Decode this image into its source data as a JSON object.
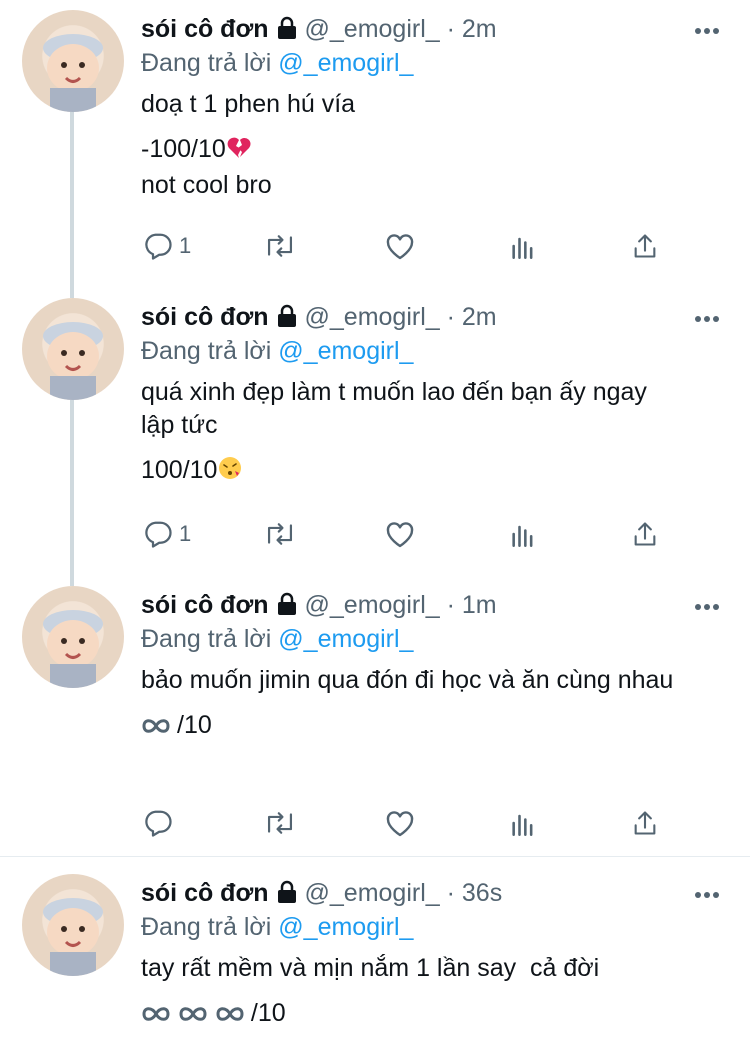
{
  "tweets": [
    {
      "name": "sói cô đơn",
      "handle": "@_emogirl_",
      "time": "· 2m",
      "reply_label": "Đang trả lời",
      "reply_mention": "@_emogirl_",
      "lines": [
        "doạ t 1 phen hú vía",
        "-100/10",
        "not cool bro"
      ],
      "line_emoji": [
        "",
        "broken-heart-emoji",
        ""
      ],
      "reply_count": "1"
    },
    {
      "name": "sói cô đơn",
      "handle": "@_emogirl_",
      "time": "· 2m",
      "reply_label": "Đang trả lời",
      "reply_mention": "@_emogirl_",
      "lines": [
        "quá xinh đẹp làm t muốn lao đến bạn ấy ngay lập tức",
        "100/10"
      ],
      "line_emoji": [
        "",
        "kissing-face-emoji"
      ],
      "reply_count": "1"
    },
    {
      "name": "sói cô đơn",
      "handle": "@_emogirl_",
      "time": "· 1m",
      "reply_label": "Đang trả lời",
      "reply_mention": "@_emogirl_",
      "lines": [
        "bảo muốn jimin qua đón đi học và ăn cùng nhau",
        "/10"
      ],
      "line_emoji": [
        "",
        "infinity-emoji"
      ],
      "reply_count": ""
    },
    {
      "name": "sói cô đơn",
      "handle": "@_emogirl_",
      "time": "· 36s",
      "reply_label": "Đang trả lời",
      "reply_mention": "@_emogirl_",
      "lines": [
        "tay rất mềm và mịn nắm 1 lần say  cả đời",
        "/10"
      ],
      "line_emoji": [
        "",
        "infinity-emoji x3"
      ],
      "reply_count": ""
    }
  ],
  "colors": {
    "accent": "#1d9bf0",
    "secondary_text": "#536471",
    "primary_text": "#0f1419",
    "thread_line": "#cfd9de"
  },
  "icons": [
    "reply-icon",
    "retweet-icon",
    "like-icon",
    "analytics-icon",
    "share-icon",
    "more-icon",
    "lock-icon"
  ]
}
